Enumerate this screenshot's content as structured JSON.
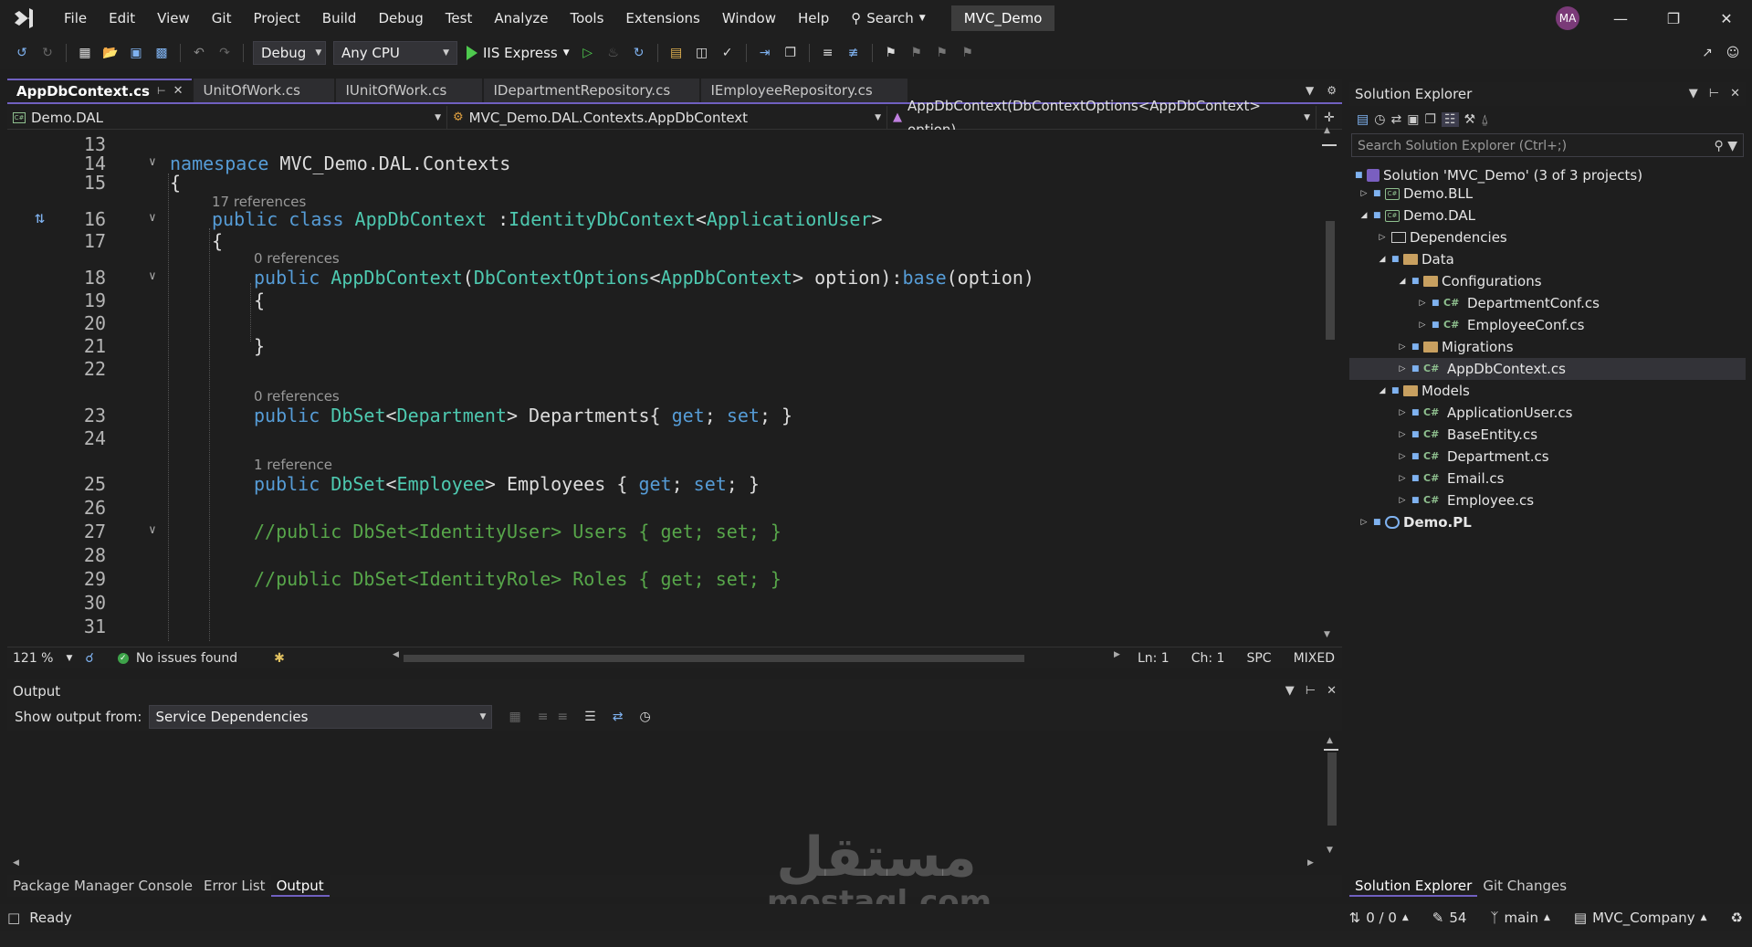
{
  "titlebar": {
    "menu": [
      "File",
      "Edit",
      "View",
      "Git",
      "Project",
      "Build",
      "Debug",
      "Test",
      "Analyze",
      "Tools",
      "Extensions",
      "Window",
      "Help"
    ],
    "search_label": "Search",
    "solution_name": "MVC_Demo",
    "user_initials": "MA"
  },
  "toolbar": {
    "configuration": "Debug",
    "platform": "Any CPU",
    "run_target": "IIS Express"
  },
  "editor": {
    "tabs": [
      {
        "label": "AppDbContext.cs",
        "active": true
      },
      {
        "label": "UnitOfWork.cs"
      },
      {
        "label": "IUnitOfWork.cs"
      },
      {
        "label": "IDepartmentRepository.cs"
      },
      {
        "label": "IEmployeeRepository.cs"
      }
    ],
    "nav_project": "Demo.DAL",
    "nav_type": "MVC_Demo.DAL.Contexts.AppDbContext",
    "nav_member": "AppDbContext(DbContextOptions<AppDbContext> option)",
    "refs": {
      "r1": "17 references",
      "r2": "0 references",
      "r3": "0 references",
      "r4": "1 reference"
    },
    "line_numbers": [
      "13",
      "14",
      "15",
      "16",
      "17",
      "18",
      "19",
      "20",
      "21",
      "22",
      "23",
      "24",
      "25",
      "26",
      "27",
      "28",
      "29",
      "30",
      "31"
    ],
    "code": {
      "l14a": "namespace",
      "l14b": " MVC_Demo",
      "l14c": ".",
      "l14d": "DAL",
      "l14e": ".",
      "l14f": "Contexts",
      "l15": "{",
      "l16a": "public",
      "l16b": " class",
      "l16c": " AppDbContext",
      "l16d": " :",
      "l16e": "IdentityDbContext",
      "l16f": "<",
      "l16g": "ApplicationUser",
      "l16h": ">",
      "l17": "{",
      "l18a": "public",
      "l18b": " AppDbContext",
      "l18c": "(",
      "l18d": "DbContextOptions",
      "l18e": "<",
      "l18f": "AppDbContext",
      "l18g": "> option):",
      "l18h": "base",
      "l18i": "(option)",
      "l19": "{",
      "l21": "}",
      "l23a": "public",
      "l23b": " DbSet",
      "l23c": "<",
      "l23d": "Department",
      "l23e": "> Departments{ ",
      "l23f": "get",
      "l23g": "; ",
      "l23h": "set",
      "l23i": "; }",
      "l25a": "public",
      "l25b": " DbSet",
      "l25c": "<",
      "l25d": "Employee",
      "l25e": "> Employees { ",
      "l25f": "get",
      "l25g": "; ",
      "l25h": "set",
      "l25i": "; }",
      "l27": "//public DbSet<IdentityUser> Users { get; set; }",
      "l29": "//public DbSet<IdentityRole> Roles { get; set; }"
    },
    "zoom": "121 %",
    "issues": "No issues found",
    "ln": "Ln: 1",
    "ch": "Ch: 1",
    "spc": "SPC",
    "eol": "MIXED"
  },
  "output": {
    "title": "Output",
    "show_from_label": "Show output from:",
    "source": "Service Dependencies"
  },
  "bottom_tabs": [
    "Package Manager Console",
    "Error List",
    "Output"
  ],
  "solution_explorer": {
    "title": "Solution Explorer",
    "search_placeholder": "Search Solution Explorer (Ctrl+;)",
    "nodes": {
      "solution": "Solution 'MVC_Demo' (3 of 3 projects)",
      "bll": "Demo.BLL",
      "dal": "Demo.DAL",
      "deps": "Dependencies",
      "data": "Data",
      "configs": "Configurations",
      "deptconf": "DepartmentConf.cs",
      "empconf": "EmployeeConf.cs",
      "migrations": "Migrations",
      "appdb": "AppDbContext.cs",
      "models": "Models",
      "appuser": "ApplicationUser.cs",
      "baseentity": "BaseEntity.cs",
      "department": "Department.cs",
      "email": "Email.cs",
      "employee": "Employee.cs",
      "pl": "Demo.PL"
    },
    "bottom_tabs": [
      "Solution Explorer",
      "Git Changes"
    ]
  },
  "statusbar": {
    "ready": "Ready",
    "changes": "0 / 0",
    "edits": "54",
    "branch": "main",
    "repo": "MVC_Company"
  },
  "watermark": {
    "arabic": "مستقل",
    "latin": "mostaql.com"
  }
}
